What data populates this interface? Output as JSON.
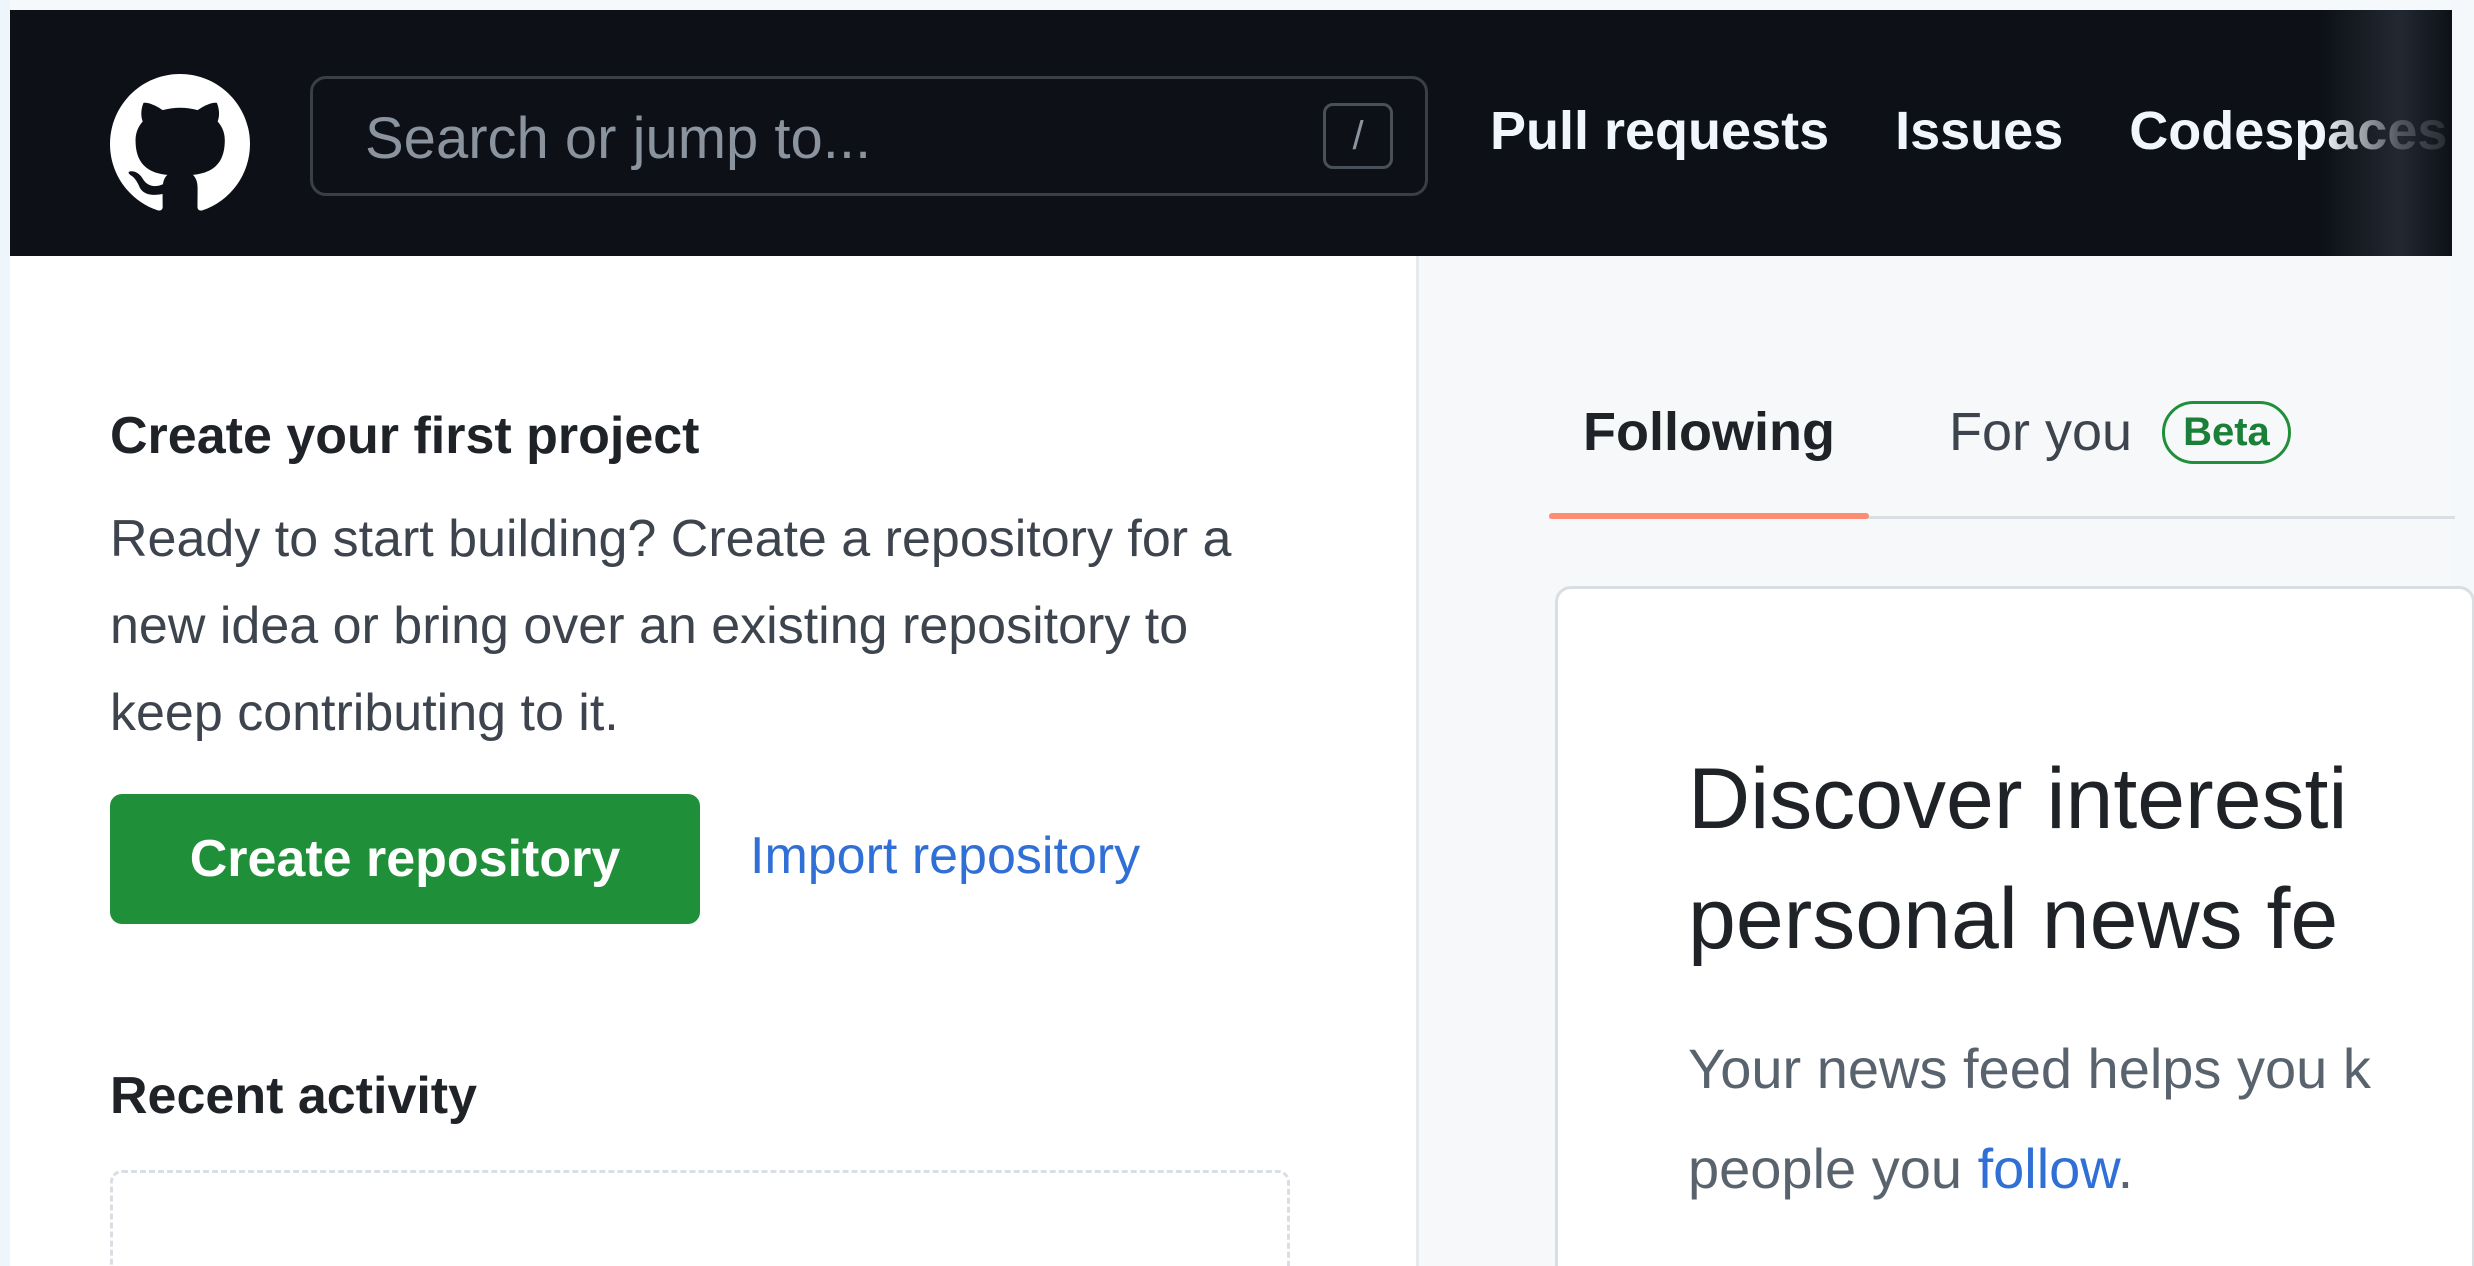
{
  "header": {
    "search": {
      "placeholder": "Search or jump to...",
      "shortcut": "/"
    },
    "nav": [
      "Pull requests",
      "Issues",
      "Codespaces"
    ]
  },
  "left": {
    "project_title": "Create your first project",
    "project_description": "Ready to start building? Create a repository for a new idea or bring over an existing repository to keep contributing to it.",
    "create_button": "Create repository",
    "import_link": "Import repository",
    "recent_title": "Recent activity"
  },
  "feed": {
    "tabs": {
      "following": "Following",
      "for_you": "For you",
      "beta_badge": "Beta"
    },
    "card": {
      "heading_line1": "Discover interesti",
      "heading_line2": "personal news fe",
      "text_prefix": "Your news feed helps you k",
      "text_line2_prefix": "people you ",
      "text_link": "follow",
      "text_suffix": "."
    }
  },
  "colors": {
    "header_bg": "#0d1117",
    "primary_button": "#1f8f39",
    "link": "#2f6fd6",
    "active_tab_underline": "#fd8c73"
  },
  "icons": [
    "github-logo-icon"
  ]
}
